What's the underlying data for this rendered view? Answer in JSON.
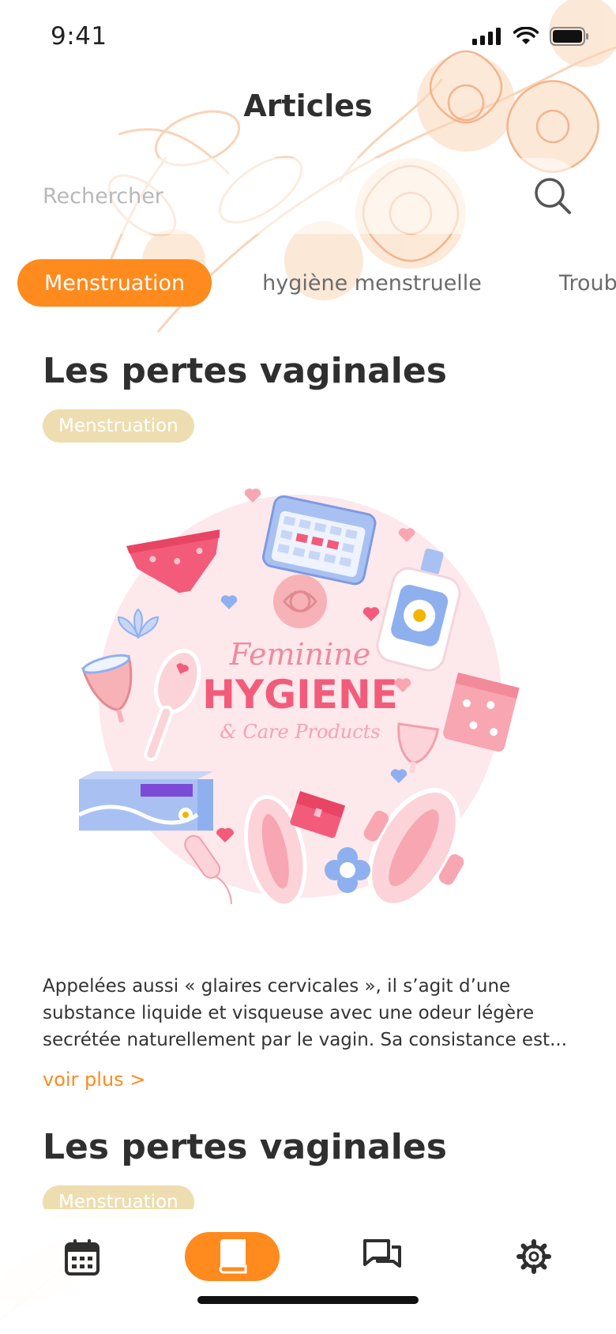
{
  "status_bar": {
    "time": "9:41"
  },
  "header": {
    "title": "Articles"
  },
  "search": {
    "placeholder": "Rechercher",
    "icon": "search-icon"
  },
  "tabs": [
    {
      "label": "Menstruation",
      "active": true
    },
    {
      "label": "hygiène menstruelle",
      "active": false
    },
    {
      "label": "Troub",
      "active": false
    }
  ],
  "articles": [
    {
      "title": "Les pertes vaginales",
      "badge": "Menstruation",
      "image": {
        "title": "Feminine",
        "subtitle": "HYGIENE",
        "tagline": "& Care Products"
      },
      "excerpt": "Appelées aussi « glaires cervicales », il s’agit d’une substance liquide et visqueuse avec une odeur légère secrétée naturellement par le vagin. Sa consistance est...",
      "read_more": "voir plus  >"
    },
    {
      "title": "Les pertes vaginales",
      "badge": "Menstruation"
    }
  ],
  "bottom_nav": [
    {
      "icon": "calendar-icon",
      "active": false
    },
    {
      "icon": "book-icon",
      "active": true
    },
    {
      "icon": "chat-icon",
      "active": false
    },
    {
      "icon": "gear-icon",
      "active": false
    }
  ],
  "colors": {
    "accent": "#FF8A1E",
    "badge": "#EEDDB0",
    "floral": "#F9C8A0"
  }
}
